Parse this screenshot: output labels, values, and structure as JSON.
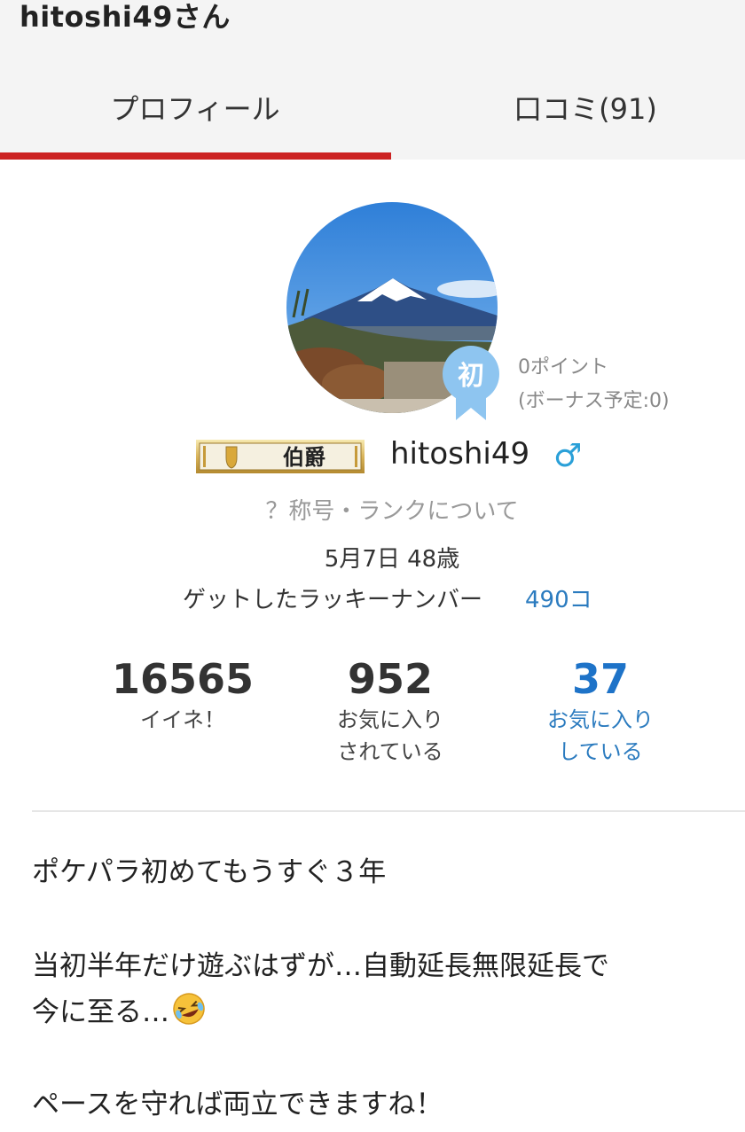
{
  "header": {
    "title": "hitoshi49さん",
    "tabs": [
      {
        "label": "プロフィール"
      },
      {
        "label": "口コミ(91)"
      }
    ]
  },
  "profile": {
    "badge_text": "初",
    "points": "0ポイント",
    "bonus": "(ボーナス予定:0)",
    "rank_title": "伯爵",
    "username": "hitoshi49",
    "gender_symbol": "♂",
    "rank_link": "？称号・ランクについて",
    "birthday": "5月7日 48歳",
    "lucky_label": "ゲットしたラッキーナンバー",
    "lucky_value": "490コ"
  },
  "stats": [
    {
      "value": "16565",
      "label_line1": "イイネ！",
      "label_line2": ""
    },
    {
      "value": "952",
      "label_line1": "お気に入り",
      "label_line2": "されている"
    },
    {
      "value": "37",
      "label_line1": "お気に入り",
      "label_line2": "している"
    }
  ],
  "bio": {
    "line1": "ポケパラ初めてもうすぐ３年",
    "line2": "当初半年だけ遊ぶはずが…自動延長無限延長で",
    "line3": "今に至る…",
    "line4": "ペースを守れば両立できますね！"
  },
  "colors": {
    "accent_red": "#cc2222",
    "link_blue": "#2b7bbf",
    "gender_blue": "#2aa0d8",
    "badge_blue": "#8ec5f0"
  }
}
